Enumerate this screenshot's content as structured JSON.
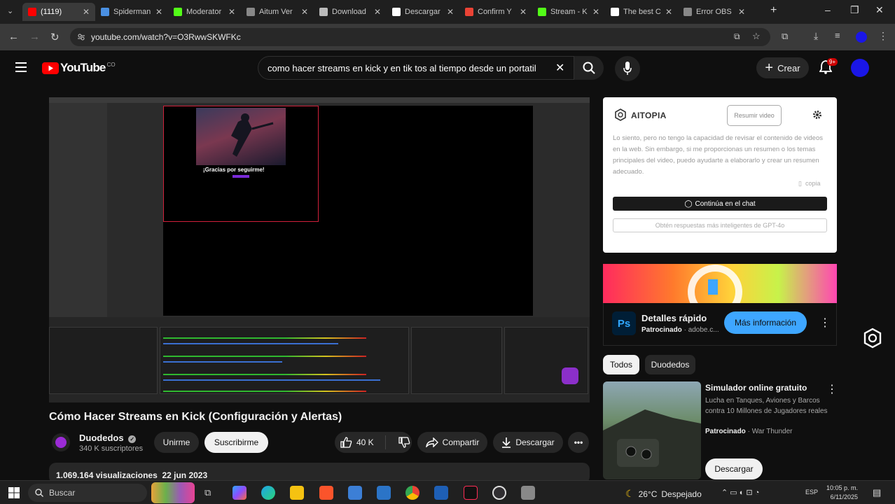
{
  "browser": {
    "tabs": [
      {
        "title": "(1119)",
        "favicon": "youtube-icon",
        "color": "#ff0000",
        "active": true
      },
      {
        "title": "Spiderman",
        "favicon": "doc-icon",
        "color": "#4a90e2"
      },
      {
        "title": "Moderator",
        "favicon": "kick-icon",
        "color": "#53fc18"
      },
      {
        "title": "Aitum Ver",
        "favicon": "globe-icon",
        "color": "#888888"
      },
      {
        "title": "Download",
        "favicon": "obs-icon",
        "color": "#bbbbbb"
      },
      {
        "title": "Descargar",
        "favicon": "tiktok-icon",
        "color": "#ffffff"
      },
      {
        "title": "Confirm Y",
        "favicon": "gmail-icon",
        "color": "#ea4335"
      },
      {
        "title": "Stream - K",
        "favicon": "kick-icon",
        "color": "#53fc18"
      },
      {
        "title": "The best C",
        "favicon": "diamond-icon",
        "color": "#ffffff"
      },
      {
        "title": "Error OBS",
        "favicon": "globe-icon",
        "color": "#888888"
      }
    ],
    "url": "youtube.com/watch?v=O3RwwSKWFKc"
  },
  "youtube": {
    "logo_text": "YouTube",
    "logo_country": "CO",
    "search_query": "como hacer streams en kick y en tik tos al tiempo desde un portatil",
    "create_label": "Crear",
    "notifications_badge": "9+"
  },
  "player": {
    "overlay_text": "¡Gracias por seguirme!"
  },
  "video": {
    "title": "Cómo Hacer Streams en Kick (Configuración y Alertas)",
    "channel_name": "Duodedos",
    "subscribers": "340 K suscriptores",
    "join_label": "Unirme",
    "subscribe_label": "Suscribirme",
    "likes": "40 K",
    "share_label": "Compartir",
    "download_label": "Descargar",
    "views": "1.069.164 visualizaciones",
    "date": "22 jun 2023"
  },
  "aitopia": {
    "title": "AITOPIA",
    "summarize_label": "Resumir video",
    "message": "Lo siento, pero no tengo la capacidad de revisar el contenido de videos en la web. Sin embargo, si me proporcionas un resumen o los temas principales del video, puedo ayudarte a elaborarlo y crear un resumen adecuado.",
    "copy_label": "copia",
    "continue_label": "Continúa en el chat",
    "gpt_label": "Obtén respuestas más inteligentes de GPT-4o"
  },
  "ad": {
    "title": "Detalles rápido",
    "sponsored": "Patrocinado",
    "domain": "adobe.c...",
    "cta": "Más información"
  },
  "chips": [
    "Todos",
    "Duodedos"
  ],
  "recommendation": {
    "title": "Simulador online gratuito",
    "description": "Lucha en Tanques, Aviones y Barcos contra 10 Millones de Jugadores reales",
    "sponsored": "Patrocinado",
    "advertiser": "War Thunder",
    "button": "Descargar"
  },
  "taskbar": {
    "search_placeholder": "Buscar",
    "weather": "26°C",
    "weather_desc": "Despejado",
    "lang": "ESP",
    "time": "10:05 p. m.",
    "date": "6/11/2025"
  }
}
